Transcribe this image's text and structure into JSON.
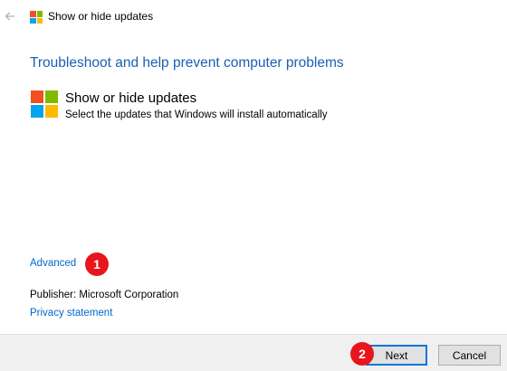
{
  "window": {
    "title": "Show or hide updates",
    "back_icon": "arrow-left-icon",
    "logo_icon": "windows-logo-icon",
    "logo_colors": [
      "#f25022",
      "#7fba00",
      "#00a4ef",
      "#ffb900"
    ]
  },
  "main": {
    "headline": "Troubleshoot and help prevent computer problems",
    "task": {
      "title": "Show or hide updates",
      "description": "Select the updates that Windows will install automatically",
      "icon": "windows-logo-icon"
    },
    "advanced_link": "Advanced",
    "publisher": "Publisher:  Microsoft Corporation",
    "privacy_link": "Privacy statement"
  },
  "annotations": {
    "step1": "1",
    "step2": "2",
    "color": "#e8151c"
  },
  "footer": {
    "next_label": "Next",
    "cancel_label": "Cancel"
  },
  "colors": {
    "headline": "#1a5fb4",
    "link": "#0066cc",
    "footer_bg": "#f0f0f0"
  }
}
